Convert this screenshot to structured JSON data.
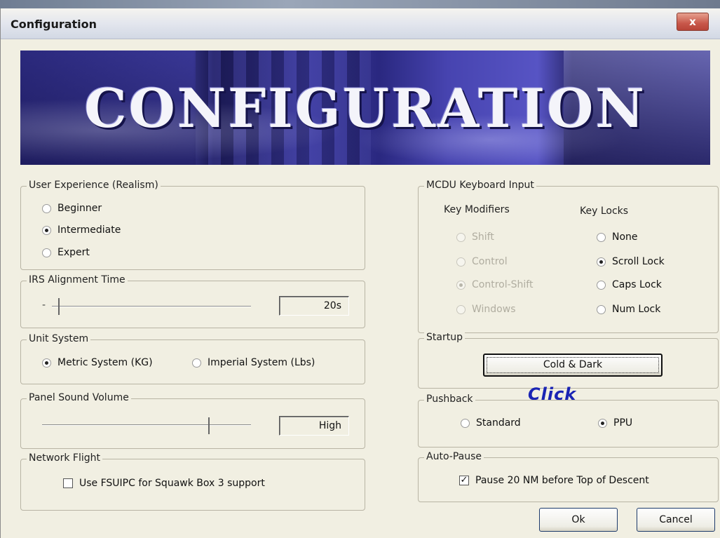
{
  "window": {
    "title": "Configuration",
    "close_label": "x"
  },
  "banner": {
    "text": "CONFIGURATION"
  },
  "user_experience": {
    "label": "User Experience (Realism)",
    "options": [
      "Beginner",
      "Intermediate",
      "Expert"
    ],
    "selected": "Intermediate"
  },
  "irs": {
    "label": "IRS Alignment Time",
    "min_tick": "-",
    "value": "20s"
  },
  "unit_system": {
    "label": "Unit System",
    "metric": "Metric System (KG)",
    "imperial": "Imperial System (Lbs)",
    "selected": "Metric System (KG)"
  },
  "panel_sound": {
    "label": "Panel Sound Volume",
    "value": "High"
  },
  "network": {
    "label": "Network Flight",
    "checkbox_label": "Use FSUIPC for Squawk Box 3 support",
    "checked": false
  },
  "mcdu": {
    "label": "MCDU Keyboard Input",
    "modifiers_header": "Key Modifiers",
    "modifiers": [
      "Shift",
      "Control",
      "Control-Shift",
      "Windows"
    ],
    "modifiers_selected": "Control-Shift",
    "locks_header": "Key Locks",
    "locks": [
      "None",
      "Scroll Lock",
      "Caps Lock",
      "Num Lock"
    ],
    "locks_selected": "Scroll Lock"
  },
  "startup": {
    "label": "Startup",
    "button": "Cold & Dark",
    "annotation": "Click"
  },
  "pushback": {
    "label": "Pushback",
    "standard": "Standard",
    "ppu": "PPU",
    "selected": "PPU"
  },
  "autopause": {
    "label": "Auto-Pause",
    "checkbox_label": "Pause 20 NM before Top of Descent",
    "checked": true
  },
  "footer": {
    "ok": "Ok",
    "cancel": "Cancel"
  },
  "colors": {
    "accent_blue": "#1a24b4",
    "window_bg": "#f1efe2",
    "banner_blue": "#3d3b9c"
  }
}
